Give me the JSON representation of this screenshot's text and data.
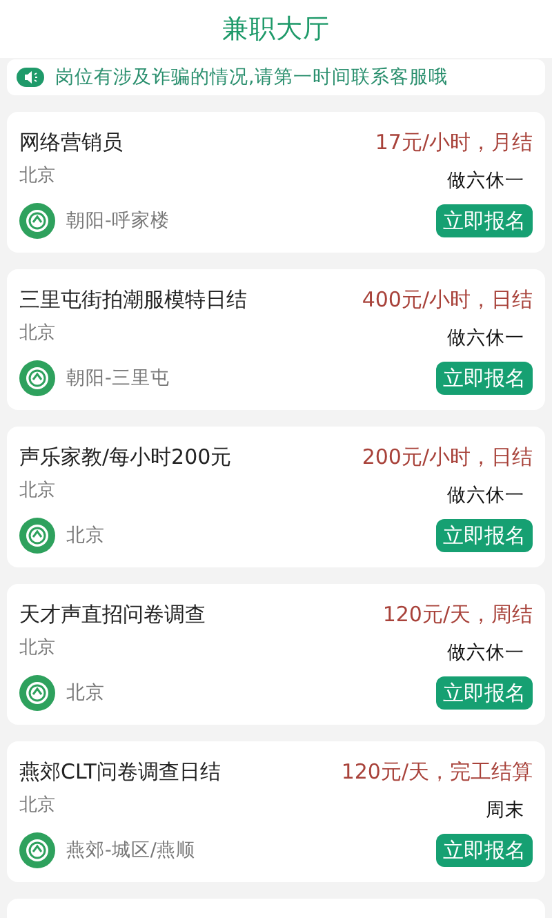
{
  "header": {
    "title": "兼职大厅"
  },
  "notice": {
    "text": "岗位有涉及诈骗的情况,请第一时间联系客服哦"
  },
  "jobs": [
    {
      "title": "网络营销员",
      "pay": "17元/小时，月结",
      "city": "北京",
      "schedule": "做六休一",
      "area": "朝阳-呼家楼",
      "button": "立即报名"
    },
    {
      "title": "三里屯街拍潮服模特日结",
      "pay": "400元/小时，日结",
      "city": "北京",
      "schedule": "做六休一",
      "area": "朝阳-三里屯",
      "button": "立即报名"
    },
    {
      "title": "声乐家教/每小时200元",
      "pay": "200元/小时，日结",
      "city": "北京",
      "schedule": "做六休一",
      "area": "北京",
      "button": "立即报名"
    },
    {
      "title": "天才声直招问卷调查",
      "pay": "120元/天，周结",
      "city": "北京",
      "schedule": "做六休一",
      "area": "北京",
      "button": "立即报名"
    },
    {
      "title": "燕郊CLT问卷调查日结",
      "pay": "120元/天，完工结算",
      "city": "北京",
      "schedule": "周末",
      "area": "燕郊-城区/燕顺",
      "button": "立即报名"
    }
  ]
}
